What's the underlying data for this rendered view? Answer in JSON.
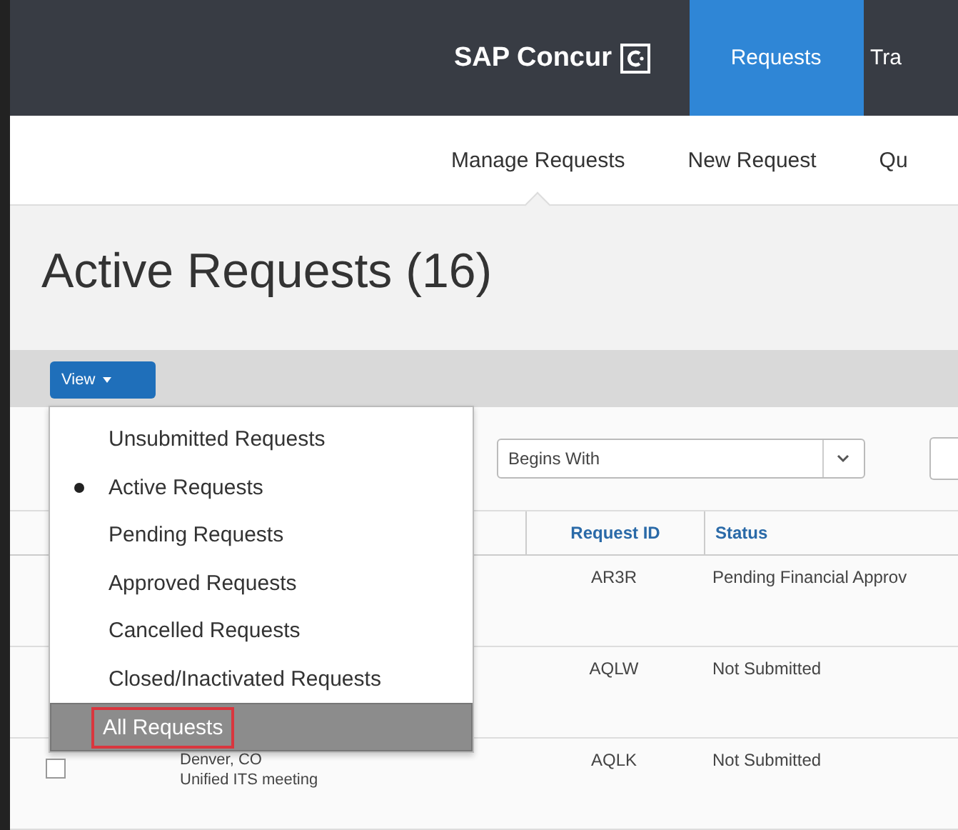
{
  "header": {
    "logo": "SAP Concur",
    "tabs": [
      {
        "label": "Requests",
        "selected": true
      },
      {
        "label": "Tra",
        "selected": false
      }
    ]
  },
  "subnav": [
    {
      "label": "Manage Requests",
      "selected": true
    },
    {
      "label": "New Request",
      "selected": false
    },
    {
      "label": "Qu",
      "selected": false
    }
  ],
  "page_title": "Active Requests (16)",
  "view_button": "View",
  "view_menu": [
    {
      "label": "Unsubmitted Requests",
      "selected": false,
      "hovered": false
    },
    {
      "label": "Active Requests",
      "selected": true,
      "hovered": false
    },
    {
      "label": "Pending Requests",
      "selected": false,
      "hovered": false
    },
    {
      "label": "Approved Requests",
      "selected": false,
      "hovered": false
    },
    {
      "label": "Cancelled Requests",
      "selected": false,
      "hovered": false
    },
    {
      "label": "Closed/Inactivated Requests",
      "selected": false,
      "hovered": false
    },
    {
      "label": "All Requests",
      "selected": false,
      "hovered": true
    }
  ],
  "filter": {
    "value": "Begins With"
  },
  "table": {
    "columns": [
      "Request ID",
      "Status"
    ],
    "rows": [
      {
        "request_id": "AR3R",
        "status": "Pending Financial Approv"
      },
      {
        "request_id": "AQLW",
        "status": "Not Submitted"
      },
      {
        "request_id": "AQLK",
        "status": "Not Submitted",
        "name": "Denver, CO",
        "purpose": "Unified ITS meeting",
        "checked": false
      }
    ]
  }
}
